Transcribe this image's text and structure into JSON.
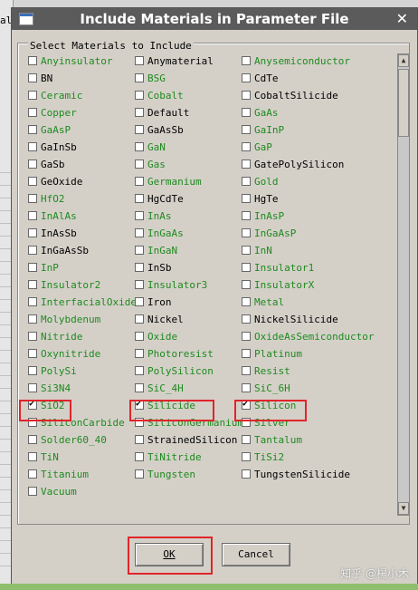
{
  "background": {
    "label": "al"
  },
  "dialog": {
    "title": "Include Materials in Parameter File",
    "group_label": "Select Materials to Include",
    "ok_label": "OK",
    "cancel_label": "Cancel"
  },
  "colors": {
    "green_text": "#1f8a1f",
    "black_text": "#000000",
    "highlight": "#e0242a"
  },
  "watermark": "知乎 @楊小木",
  "materials": [
    [
      {
        "name": "Anyinsulator",
        "color": "green",
        "checked": false
      },
      {
        "name": "BN",
        "color": "black",
        "checked": false
      },
      {
        "name": "Ceramic",
        "color": "green",
        "checked": false
      },
      {
        "name": "Copper",
        "color": "green",
        "checked": false
      },
      {
        "name": "GaAsP",
        "color": "green",
        "checked": false
      },
      {
        "name": "GaInSb",
        "color": "black",
        "checked": false
      },
      {
        "name": "GaSb",
        "color": "black",
        "checked": false
      },
      {
        "name": "GeOxide",
        "color": "black",
        "checked": false
      },
      {
        "name": "HfO2",
        "color": "green",
        "checked": false
      },
      {
        "name": "InAlAs",
        "color": "green",
        "checked": false
      },
      {
        "name": "InAsSb",
        "color": "black",
        "checked": false
      },
      {
        "name": "InGaAsSb",
        "color": "black",
        "checked": false
      },
      {
        "name": "InP",
        "color": "green",
        "checked": false
      },
      {
        "name": "Insulator2",
        "color": "green",
        "checked": false
      },
      {
        "name": "InterfacialOxide",
        "color": "green",
        "checked": false
      },
      {
        "name": "Molybdenum",
        "color": "green",
        "checked": false
      },
      {
        "name": "Nitride",
        "color": "green",
        "checked": false
      },
      {
        "name": "Oxynitride",
        "color": "green",
        "checked": false
      },
      {
        "name": "PolySi",
        "color": "green",
        "checked": false
      },
      {
        "name": "Si3N4",
        "color": "green",
        "checked": false
      },
      {
        "name": "SiO2",
        "color": "green",
        "checked": true
      },
      {
        "name": "SiliconCarbide",
        "color": "green",
        "checked": false
      },
      {
        "name": "Solder60_40",
        "color": "green",
        "checked": false
      },
      {
        "name": "TiN",
        "color": "green",
        "checked": false
      },
      {
        "name": "Titanium",
        "color": "green",
        "checked": false
      },
      {
        "name": "Vacuum",
        "color": "green",
        "checked": false
      }
    ],
    [
      {
        "name": "Anymaterial",
        "color": "black",
        "checked": false
      },
      {
        "name": "BSG",
        "color": "green",
        "checked": false
      },
      {
        "name": "Cobalt",
        "color": "green",
        "checked": false
      },
      {
        "name": "Default",
        "color": "black",
        "checked": false
      },
      {
        "name": "GaAsSb",
        "color": "black",
        "checked": false
      },
      {
        "name": "GaN",
        "color": "green",
        "checked": false
      },
      {
        "name": "Gas",
        "color": "green",
        "checked": false
      },
      {
        "name": "Germanium",
        "color": "green",
        "checked": false
      },
      {
        "name": "HgCdTe",
        "color": "black",
        "checked": false
      },
      {
        "name": "InAs",
        "color": "green",
        "checked": false
      },
      {
        "name": "InGaAs",
        "color": "green",
        "checked": false
      },
      {
        "name": "InGaN",
        "color": "green",
        "checked": false
      },
      {
        "name": "InSb",
        "color": "black",
        "checked": false
      },
      {
        "name": "Insulator3",
        "color": "green",
        "checked": false
      },
      {
        "name": "Iron",
        "color": "black",
        "checked": false
      },
      {
        "name": "Nickel",
        "color": "black",
        "checked": false
      },
      {
        "name": "Oxide",
        "color": "green",
        "checked": false
      },
      {
        "name": "Photoresist",
        "color": "green",
        "checked": false
      },
      {
        "name": "PolySilicon",
        "color": "green",
        "checked": false
      },
      {
        "name": "SiC_4H",
        "color": "green",
        "checked": false
      },
      {
        "name": "Silicide",
        "color": "green",
        "checked": true
      },
      {
        "name": "SiliconGermanium",
        "color": "green",
        "checked": false
      },
      {
        "name": "StrainedSilicon",
        "color": "black",
        "checked": false
      },
      {
        "name": "TiNitride",
        "color": "green",
        "checked": false
      },
      {
        "name": "Tungsten",
        "color": "green",
        "checked": false
      }
    ],
    [
      {
        "name": "Anysemiconductor",
        "color": "green",
        "checked": false
      },
      {
        "name": "CdTe",
        "color": "black",
        "checked": false
      },
      {
        "name": "CobaltSilicide",
        "color": "black",
        "checked": false
      },
      {
        "name": "GaAs",
        "color": "green",
        "checked": false
      },
      {
        "name": "GaInP",
        "color": "green",
        "checked": false
      },
      {
        "name": "GaP",
        "color": "green",
        "checked": false
      },
      {
        "name": "GatePolySilicon",
        "color": "black",
        "checked": false
      },
      {
        "name": "Gold",
        "color": "green",
        "checked": false
      },
      {
        "name": "HgTe",
        "color": "black",
        "checked": false
      },
      {
        "name": "InAsP",
        "color": "green",
        "checked": false
      },
      {
        "name": "InGaAsP",
        "color": "green",
        "checked": false
      },
      {
        "name": "InN",
        "color": "green",
        "checked": false
      },
      {
        "name": "Insulator1",
        "color": "green",
        "checked": false
      },
      {
        "name": "InsulatorX",
        "color": "green",
        "checked": false
      },
      {
        "name": "Metal",
        "color": "green",
        "checked": false
      },
      {
        "name": "NickelSilicide",
        "color": "black",
        "checked": false
      },
      {
        "name": "OxideAsSemiconductor",
        "color": "green",
        "checked": false
      },
      {
        "name": "Platinum",
        "color": "green",
        "checked": false
      },
      {
        "name": "Resist",
        "color": "green",
        "checked": false
      },
      {
        "name": "SiC_6H",
        "color": "green",
        "checked": false
      },
      {
        "name": "Silicon",
        "color": "green",
        "checked": true
      },
      {
        "name": "Silver",
        "color": "green",
        "checked": false
      },
      {
        "name": "Tantalum",
        "color": "green",
        "checked": false
      },
      {
        "name": "TiSi2",
        "color": "green",
        "checked": false
      },
      {
        "name": "TungstenSilicide",
        "color": "black",
        "checked": false
      }
    ]
  ]
}
